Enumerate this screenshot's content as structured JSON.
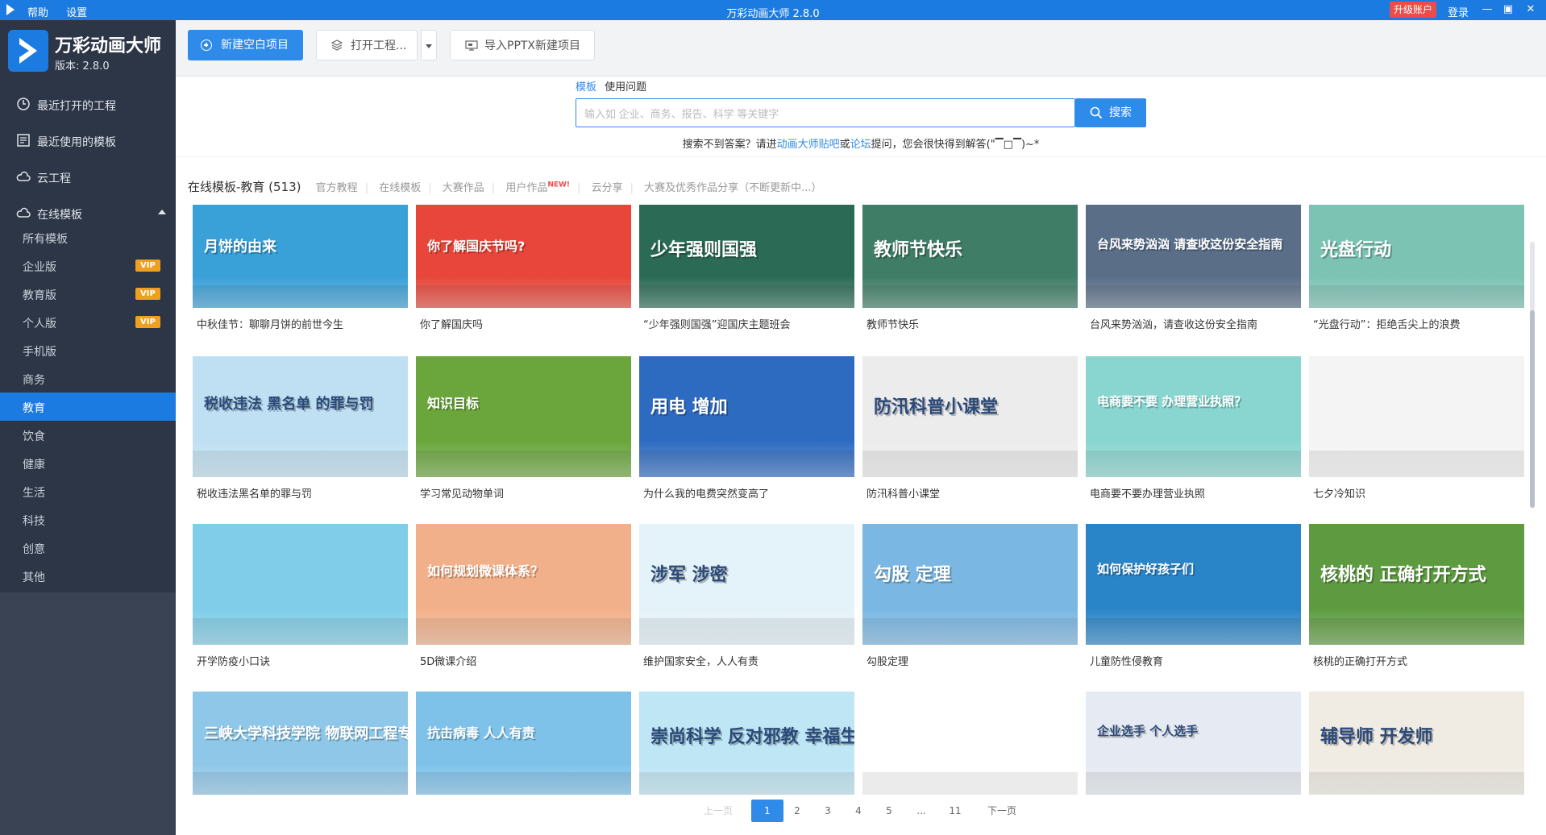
{
  "titlebar": {
    "menu": [
      "帮助",
      "设置"
    ],
    "title": "万彩动画大师 2.8.0",
    "upgrade_label": "升级账户",
    "login_label": "登录",
    "min_symbol": "—",
    "max_symbol": "▣",
    "close_symbol": "✕"
  },
  "brand": {
    "name": "万彩动画大师",
    "version": "版本: 2.8.0"
  },
  "sidebar": {
    "nav": [
      {
        "label": "最近打开的工程",
        "icon": "clock-icon"
      },
      {
        "label": "最近使用的模板",
        "icon": "template-icon"
      },
      {
        "label": "云工程",
        "icon": "cloud-icon"
      },
      {
        "label": "在线模板",
        "icon": "cloud-icon"
      }
    ],
    "sub": [
      {
        "label": "所有模板",
        "vip": false
      },
      {
        "label": "企业版",
        "vip": true
      },
      {
        "label": "教育版",
        "vip": true
      },
      {
        "label": "个人版",
        "vip": true
      },
      {
        "label": "手机版",
        "vip": false
      },
      {
        "label": "商务",
        "vip": false
      },
      {
        "label": "教育",
        "vip": false,
        "active": true
      },
      {
        "label": "饮食",
        "vip": false
      },
      {
        "label": "健康",
        "vip": false
      },
      {
        "label": "生活",
        "vip": false
      },
      {
        "label": "科技",
        "vip": false
      },
      {
        "label": "创意",
        "vip": false
      },
      {
        "label": "其他",
        "vip": false
      }
    ],
    "vip_label": "VIP"
  },
  "toolbar": {
    "new_label": "新建空白项目",
    "open_label": "打开工程...",
    "import_label": "导入PPTX新建项目"
  },
  "search": {
    "tabs": [
      "模板",
      "使用问题"
    ],
    "placeholder": "输入如 企业、商务、报告、科学 等关键字",
    "button_label": "搜索",
    "hint_prefix": "搜索不到答案？请进",
    "hint_link1": "动画大师贴吧",
    "hint_mid": "或",
    "hint_link2": "论坛",
    "hint_suffix": "提问，您会很快得到解答(\"▔□▔)~*"
  },
  "filters": {
    "main": "在线模板-教育 (513)",
    "items": [
      "官方教程",
      "在线模板",
      "大赛作品",
      "用户作品",
      "云分享",
      "大赛及优秀作品分享（不断更新中...）"
    ],
    "new_badge": "NEW!"
  },
  "cards": [
    {
      "label": "中秋佳节：聊聊月饼的前世今生",
      "bg": "#3aa0d8",
      "text": "月饼的由来"
    },
    {
      "label": "你了解国庆吗",
      "bg": "#e8463a",
      "text": "你了解国庆节吗?"
    },
    {
      "label": "“少年强则国强”迎国庆主题班会",
      "bg": "#2b6b55",
      "text": "少年强则国强"
    },
    {
      "label": "教师节快乐",
      "bg": "#3f7d66",
      "text": "教师节快乐"
    },
    {
      "label": "台风来势汹汹，请查收这份安全指南",
      "bg": "#5a6e88",
      "text": "台风来势汹汹 请查收这份安全指南"
    },
    {
      "label": "“光盘行动”：拒绝舌尖上的浪费",
      "bg": "#7cc3b4",
      "text": "光盘行动"
    },
    {
      "label": "税收违法黑名单的罪与罚",
      "bg": "#bfe0f2",
      "text": "税收违法 黑名单 的罪与罚"
    },
    {
      "label": "学习常见动物单词",
      "bg": "#6aa63c",
      "text": "知识目标"
    },
    {
      "label": "为什么我的电费突然变高了",
      "bg": "#2d6bc1",
      "text": "用电 增加"
    },
    {
      "label": "防汛科普小课堂",
      "bg": "#ececec",
      "text": "防汛科普小课堂"
    },
    {
      "label": "电商要不要办理营业执照",
      "bg": "#89d6d0",
      "text": "电商要不要 办理营业执照？"
    },
    {
      "label": "七夕冷知识",
      "bg": "#f4f4f4",
      "text": ""
    },
    {
      "label": "开学防疫小口诀",
      "bg": "#7fcde8",
      "text": ""
    },
    {
      "label": "5D微课介绍",
      "bg": "#f2b08a",
      "text": "如何规划微课体系？"
    },
    {
      "label": "维护国家安全，人人有责",
      "bg": "#e4f3f9",
      "text": "涉军 涉密"
    },
    {
      "label": "勾股定理",
      "bg": "#7ab7e3",
      "text": "勾股 定理"
    },
    {
      "label": "儿童防性侵教育",
      "bg": "#2a85c8",
      "text": "如何保护好孩子们"
    },
    {
      "label": "核桃的正确打开方式",
      "bg": "#5e9b40",
      "text": "核桃的 正确打开方式"
    },
    {
      "label": "",
      "bg": "#8fc7e8",
      "text": "三峡大学科技学院 物联网工程专业"
    },
    {
      "label": "",
      "bg": "#7ec2ea",
      "text": "抗击病毒 人人有责"
    },
    {
      "label": "",
      "bg": "#bfe6f4",
      "text": "崇尚科学 反对邪教 幸福生活"
    },
    {
      "label": "",
      "bg": "#ffffff",
      "text": ""
    },
    {
      "label": "",
      "bg": "#e6eaf2",
      "text": "企业选手   个人选手"
    },
    {
      "label": "",
      "bg": "#f0ece4",
      "text": "辅导师   开发师"
    }
  ],
  "pager": {
    "prev": "上一页",
    "pages": [
      "1",
      "2",
      "3",
      "4",
      "5",
      "...",
      "11"
    ],
    "current": "1",
    "next": "下一页"
  },
  "colors": {
    "accent": "#2f8bea",
    "sidebar_bg": "#2d3646",
    "titlebar_bg": "#1c7be0",
    "vip": "#f0a020",
    "upgrade": "#ee4b4b"
  }
}
